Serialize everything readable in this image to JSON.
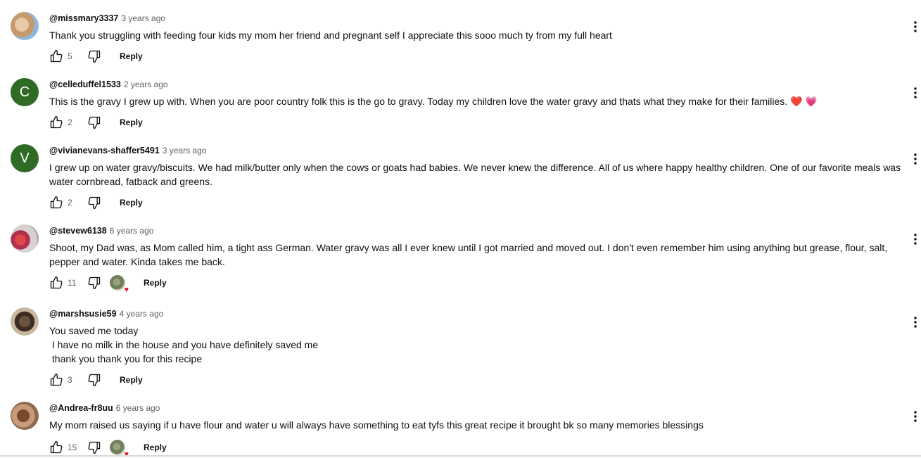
{
  "comments": [
    {
      "author": "@missmary3337",
      "time": "3 years ago",
      "avatar_icon": "user-photo-avatar",
      "text": "Thank you struggling with feeding four kids my mom her friend and pregnant self I appreciate this sooo much ty from my full heart",
      "likes": "5",
      "reply_label": "Reply"
    },
    {
      "author": "@celleduffel1533",
      "time": "2 years ago",
      "avatar_letter": "C",
      "text": "This is the gravy I grew up with. When you are poor country folk this is the go to gravy. Today my children love the water gravy and thats what they make for their families.",
      "emoji": [
        "❤️",
        "💗"
      ],
      "likes": "2",
      "reply_label": "Reply"
    },
    {
      "author": "@vivianevans-shaffer5491",
      "time": "3 years ago",
      "avatar_letter": "V",
      "text": "I grew up on water gravy/biscuits. We had milk/butter only when the cows or goats had babies. We never knew the difference. All of us where happy healthy children. One of our favorite meals was water cornbread, fatback and greens.",
      "likes": "2",
      "reply_label": "Reply"
    },
    {
      "author": "@stevew6138",
      "time": "6 years ago",
      "avatar_icon": "user-photo-avatar",
      "text": "Shoot, my Dad was, as Mom called him, a tight ass German. Water gravy was all I ever knew until I got married and moved out. I don't even remember him using anything but grease, flour, salt, pepper and water. Kinda takes me back.",
      "likes": "11",
      "creator_heart": true,
      "reply_label": "Reply"
    },
    {
      "author": "@marshsusie59",
      "time": "4 years ago",
      "avatar_icon": "user-photo-avatar",
      "text": "You saved me today\n I have no milk in the house and you have definitely saved me\n thank you thank you for this recipe",
      "likes": "3",
      "reply_label": "Reply"
    },
    {
      "author": "@Andrea-fr8uu",
      "time": "6 years ago",
      "avatar_icon": "user-photo-avatar",
      "text": "My mom raised us saying if u have flour and water u will always have something to eat tyfs this great recipe it brought bk so many memories blessings",
      "likes": "15",
      "creator_heart": true,
      "reply_label": "Reply"
    }
  ],
  "colors": {
    "letter_avatar_bg": "#2f6b24",
    "heart_red": "#e01530",
    "secondary_text": "#606060"
  }
}
